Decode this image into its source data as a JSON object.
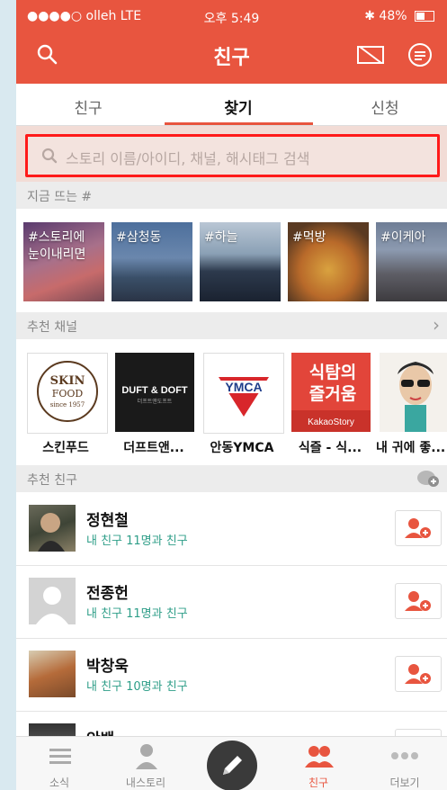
{
  "status_bar": {
    "carrier": "●●●●○ olleh  LTE",
    "time": "오후 5:49",
    "battery": "48%"
  },
  "header": {
    "title": "친구"
  },
  "tabs": [
    {
      "label": "친구"
    },
    {
      "label": "찾기"
    },
    {
      "label": "신청"
    }
  ],
  "search": {
    "placeholder": "스토리 이름/아이디, 채널, 해시태그 검색"
  },
  "trending": {
    "title": "지금 뜨는 #",
    "tags": [
      {
        "label": "#스토리에 눈이내리면"
      },
      {
        "label": "#삼청동"
      },
      {
        "label": "#하늘"
      },
      {
        "label": "#먹방"
      },
      {
        "label": "#이케아"
      }
    ]
  },
  "channels": {
    "title": "추천 채널",
    "more": "›",
    "items": [
      {
        "name": "스킨푸드",
        "logo_lines": [
          "SKIN",
          "FOOD",
          "since 1957"
        ]
      },
      {
        "name": "더프트앤...",
        "logo_lines": [
          "DUFT & DOFT",
          "더프트앤도프트"
        ]
      },
      {
        "name": "안동YMCA",
        "logo_lines": [
          "YMCA"
        ]
      },
      {
        "name": "식즐 - 식...",
        "logo_lines": [
          "식탐의",
          "즐거움",
          "KakaoStory"
        ]
      },
      {
        "name": "내 귀에 좋..."
      }
    ]
  },
  "friends": {
    "title": "추천 친구",
    "items": [
      {
        "name": "정현철",
        "sub": "내 친구 11명과 친구"
      },
      {
        "name": "전종헌",
        "sub": "내 친구 11명과 친구"
      },
      {
        "name": "박창욱",
        "sub": "내 친구 10명과 친구"
      },
      {
        "name": "안백",
        "sub": ""
      }
    ]
  },
  "bottom_nav": [
    {
      "label": "소식"
    },
    {
      "label": "내스토리"
    },
    {
      "label": ""
    },
    {
      "label": "친구"
    },
    {
      "label": "더보기"
    }
  ],
  "colors": {
    "accent": "#e8553f",
    "friend_sub": "#2e9e88",
    "highlight_border": "#ff1a1a"
  }
}
